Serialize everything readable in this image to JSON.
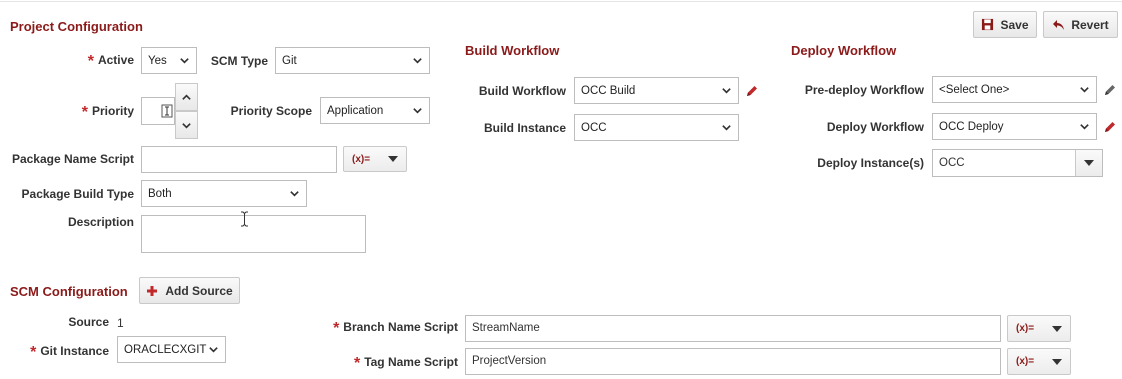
{
  "toolbar": {
    "save_label": "Save",
    "revert_label": "Revert"
  },
  "project_config": {
    "title": "Project Configuration",
    "active_label": "Active",
    "active_value": "Yes",
    "scm_type_label": "SCM Type",
    "scm_type_value": "Git",
    "priority_label": "Priority",
    "priority_scope_label": "Priority Scope",
    "priority_scope_value": "Application",
    "package_name_script_label": "Package Name Script",
    "package_name_script_value": "",
    "fx_label": "(x)=",
    "package_build_type_label": "Package Build Type",
    "package_build_type_value": "Both",
    "description_label": "Description",
    "description_value": ""
  },
  "build_workflow": {
    "title": "Build Workflow",
    "workflow_label": "Build Workflow",
    "workflow_value": "OCC Build",
    "instance_label": "Build Instance",
    "instance_value": "OCC"
  },
  "deploy_workflow": {
    "title": "Deploy Workflow",
    "predeploy_label": "Pre-deploy Workflow",
    "predeploy_value": "<Select One>",
    "deploy_label": "Deploy Workflow",
    "deploy_value": "OCC Deploy",
    "instances_label": "Deploy Instance(s)",
    "instances_value": "OCC"
  },
  "scm_config": {
    "title": "SCM Configuration",
    "add_source_label": "Add Source",
    "source_label": "Source",
    "source_value": "1",
    "git_instance_label": "Git Instance",
    "git_instance_value": "ORACLECXGIT",
    "branch_label": "Branch Name Script",
    "branch_value": "StreamName",
    "tag_label": "Tag Name Script",
    "tag_value": "ProjectVersion",
    "fx_label": "(x)="
  },
  "colors": {
    "accent": "#8b1a1a",
    "required": "#c0282a"
  }
}
